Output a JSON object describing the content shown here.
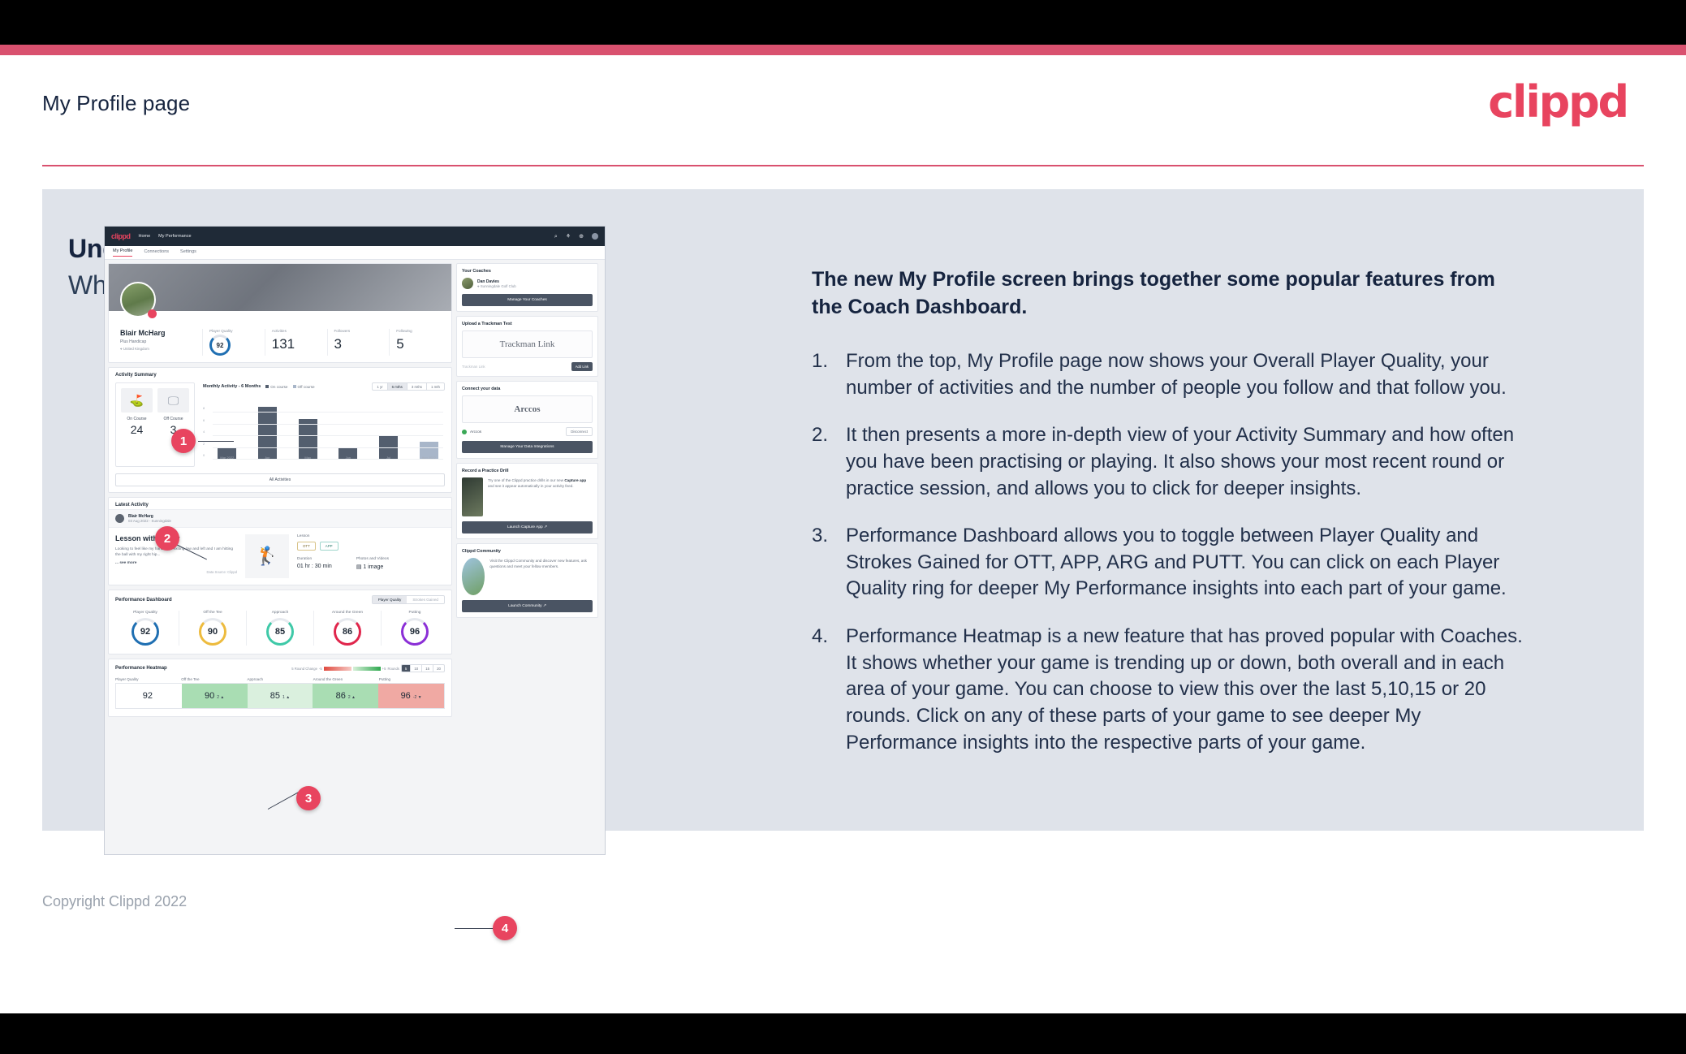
{
  "slide": {
    "header_title": "My Profile page",
    "brand": "clippd",
    "heading_main": "Understand your Profile (Players - Desktop)",
    "heading_sub": "What does your Profile show you?",
    "copyright": "Copyright Clippd 2022"
  },
  "colors": {
    "accent_pink": "#d9516f",
    "brand_pink": "#e8445f",
    "panel_bg": "#dfe3ea",
    "navy": "#16243f"
  },
  "notes": {
    "lead": "The new My Profile screen brings together some popular features from the Coach Dashboard.",
    "points": [
      {
        "num": "1.",
        "text": "From the top, My Profile page now shows your Overall Player Quality, your number of activities and the number of people you follow and that follow you."
      },
      {
        "num": "2.",
        "text": "It then presents a more in-depth view of your Activity Summary and how often you have been practising or playing. It also shows your most recent round or practice session, and allows you to click for deeper insights."
      },
      {
        "num": "3.",
        "text": "Performance Dashboard allows you to toggle between Player Quality and Strokes Gained for OTT, APP, ARG and PUTT. You can click on each Player Quality ring for deeper My Performance insights into each part of your game."
      },
      {
        "num": "4.",
        "text": "Performance Heatmap is a new feature that has proved popular with Coaches. It shows whether your game is trending up or down, both overall and in each area of your game. You can choose to view this over the last 5,10,15 or 20 rounds. Click on any of these parts of your game to see deeper My Performance insights into the respective parts of your game."
      }
    ]
  },
  "callouts": [
    {
      "label": "1"
    },
    {
      "label": "2"
    },
    {
      "label": "3"
    },
    {
      "label": "4"
    }
  ],
  "app": {
    "logo": "clippd",
    "nav_links": [
      "Home",
      "My Performance"
    ],
    "nav_icons": [
      "search-icon",
      "community-icon",
      "add-circle-icon",
      "avatar-icon"
    ],
    "tabs": [
      {
        "label": "My Profile",
        "active": true
      },
      {
        "label": "Connections",
        "active": false
      },
      {
        "label": "Settings",
        "active": false
      }
    ],
    "profile": {
      "name": "Blair McHarg",
      "handicap": "Plus Handicap",
      "location": "United Kingdom",
      "stats": [
        {
          "label": "Player Quality",
          "value": "92",
          "type": "ring"
        },
        {
          "label": "Activities",
          "value": "131",
          "type": "number"
        },
        {
          "label": "Followers",
          "value": "3",
          "type": "number"
        },
        {
          "label": "Following",
          "value": "5",
          "type": "number"
        }
      ]
    },
    "activity_summary": {
      "title": "Activity Summary",
      "on_course_label": "On Course",
      "off_course_label": "Off Course",
      "on_course_value": "24",
      "off_course_value": "3",
      "all_activities_label": "All Activities",
      "chart_title": "Monthly Activity - 6 Months",
      "legend": [
        "On course",
        "Off course"
      ],
      "range_options": [
        {
          "label": "1 yr",
          "active": false
        },
        {
          "label": "6 mths",
          "active": true
        },
        {
          "label": "3 mths",
          "active": false
        },
        {
          "label": "1 mth",
          "active": false
        }
      ]
    },
    "latest_activity": {
      "title": "Latest Activity",
      "user": "Blair McHarg",
      "date": "03 Aug 2022 - Sunningdale",
      "heading": "Lesson with Fordy",
      "body": "Looking to feel like my hands are exiting low and left and I am hitting the ball with my right hip...",
      "see_more": "... see more",
      "data_source": "Data Source: Clippd",
      "type_label": "Lesson",
      "tags": [
        "OTT",
        "APP"
      ],
      "duration_label": "Duration",
      "duration_value": "01 hr : 30 min",
      "media_label": "Photos and Videos",
      "media_value": "1 image"
    },
    "performance_dashboard": {
      "title": "Performance Dashboard",
      "toggle": [
        {
          "label": "Player Quality",
          "active": true
        },
        {
          "label": "Strokes Gained",
          "active": false
        }
      ],
      "rings": [
        {
          "label": "Player Quality",
          "value": "92",
          "color": "#1f6fb2"
        },
        {
          "label": "Off the Tee",
          "value": "90",
          "color": "#edb game"
        },
        {
          "label": "Approach",
          "value": "85",
          "color": "#3fc9a8"
        },
        {
          "label": "Around the Green",
          "value": "86",
          "color": "#e0264c"
        },
        {
          "label": "Putting",
          "value": "96",
          "color": "#8b2fd6"
        }
      ]
    },
    "performance_heatmap": {
      "title": "Performance Heatmap",
      "scale_label": "5 Round Change",
      "scale_min": "-5",
      "scale_max": "+5",
      "rounds_label": "Rounds",
      "rounds_options": [
        {
          "label": "5",
          "active": true
        },
        {
          "label": "10",
          "active": false
        },
        {
          "label": "15",
          "active": false
        },
        {
          "label": "20",
          "active": false
        }
      ],
      "cells": [
        {
          "label": "Player Quality",
          "value": "92",
          "delta": "",
          "bg": "#ffffff"
        },
        {
          "label": "Off the Tee",
          "value": "90",
          "delta": "2 ▲",
          "bg": "#a9ddb3"
        },
        {
          "label": "Approach",
          "value": "85",
          "delta": "1 ▲",
          "bg": "#daf0de"
        },
        {
          "label": "Around the Green",
          "value": "86",
          "delta": "2 ▲",
          "bg": "#a9ddb3"
        },
        {
          "label": "Putting",
          "value": "96",
          "delta": "-2 ▼",
          "bg": "#f0a9a3"
        }
      ]
    },
    "sidebar": {
      "coaches": {
        "title": "Your Coaches",
        "coach_name": "Dan Davies",
        "coach_club": "Sunningdale Golf Club",
        "button": "Manage Your Coaches"
      },
      "trackman": {
        "title": "Upload a Trackman Test",
        "brand": "Trackman Link",
        "input_placeholder": "Trackman Link",
        "button": "Add Link"
      },
      "connect": {
        "title": "Connect your data",
        "brand": "Arccos",
        "chip": "Arccos",
        "disconnect": "Disconnect",
        "button": "Manage Your Data Integrations"
      },
      "drill": {
        "title": "Record a Practice Drill",
        "text_before": "Try one of the Clippd practice drills in our new ",
        "text_bold": "Capture app",
        "text_after": " and see it appear automatically in your activity feed.",
        "button": "Launch Capture App ↗"
      },
      "community": {
        "title": "Clippd Community",
        "text": "Visit the Clippd Community and discover new features, ask questions and meet your fellow members.",
        "button": "Launch Community ↗"
      }
    }
  },
  "chart_data": {
    "type": "bar",
    "title": "Monthly Activity - 6 Months",
    "categories": [
      "Mar 2022",
      "Apr",
      "May",
      "Jun",
      "Jul",
      "Aug 2022"
    ],
    "values": [
      2,
      9,
      7,
      2,
      4,
      3
    ],
    "bar_colors": [
      "#535e6e",
      "#535e6e",
      "#535e6e",
      "#535e6e",
      "#535e6e",
      "#a8b6c9"
    ],
    "series": [
      {
        "name": "On course",
        "values": [
          2,
          9,
          7,
          2,
          4,
          0
        ],
        "color": "#535e6e"
      },
      {
        "name": "Off course",
        "values": [
          0,
          0,
          0,
          0,
          0,
          3
        ],
        "color": "#a8b6c9"
      }
    ],
    "xlabel": "",
    "ylabel": "",
    "ylim": [
      0,
      10
    ],
    "yticks": [
      0,
      2,
      4,
      6,
      8
    ],
    "grid": true,
    "legend": [
      "On course",
      "Off course"
    ],
    "legend_position": "top"
  }
}
